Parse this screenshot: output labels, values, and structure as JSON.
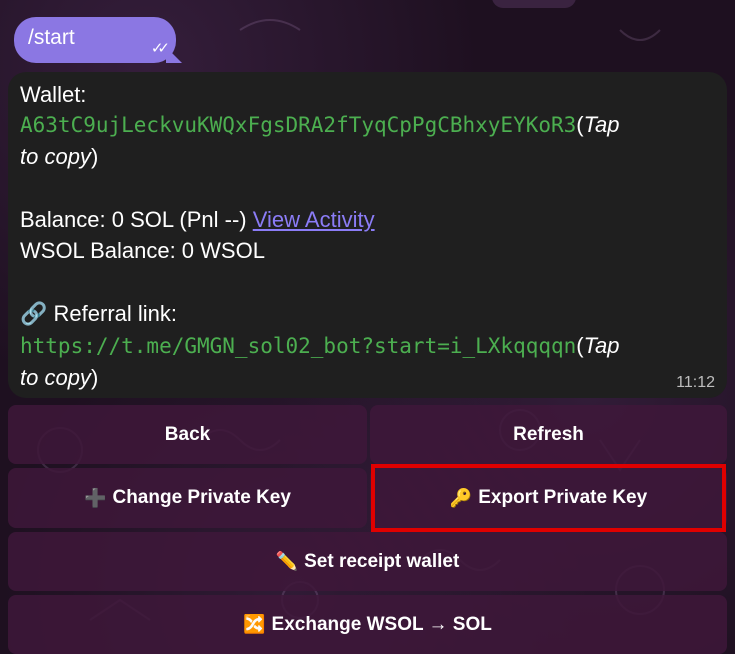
{
  "outgoing": {
    "text": "/start",
    "status_icon": "double-check-icon"
  },
  "message": {
    "wallet_label": "Wallet:",
    "wallet_address": "A63tC9ujLeckvuKWQxFgsDRA2fTyqCpPgCBhxyEYKoR3",
    "tap_prefix": "(",
    "tap_text_1": "Tap",
    "tap_text_2": "to copy",
    "tap_suffix": ")",
    "balance_text": "Balance: 0 SOL (Pnl --) ",
    "view_activity": "View Activity",
    "wsol_balance": "WSOL Balance: 0 WSOL",
    "referral_icon": "🔗",
    "referral_label": "Referral link:",
    "referral_url": "https://t.me/GMGN_sol02_bot?start=i_LXkqqqqn",
    "time": "11:12"
  },
  "keyboard": {
    "back": "Back",
    "refresh": "Refresh",
    "change_key": "Change Private Key",
    "change_key_icon": "➕",
    "export_key": "Export Private Key",
    "export_key_icon": "🔑",
    "receipt": "Set receipt wallet",
    "receipt_icon": "✏️",
    "exchange": "Exchange WSOL → SOL",
    "exchange_icon": "🔀"
  },
  "colors": {
    "accent": "#8b77e3",
    "mono_green": "#4caf50",
    "link": "#8b7cf6",
    "highlight": "#e00000"
  }
}
